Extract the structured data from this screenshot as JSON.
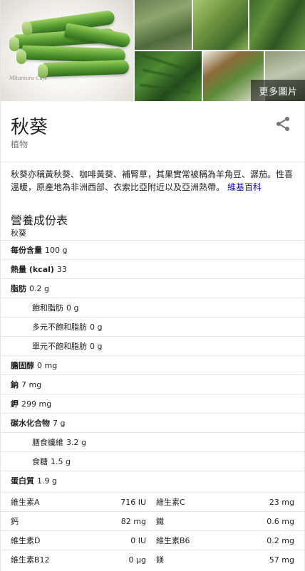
{
  "images": {
    "watermark": "Mitamura Cafe",
    "more_label": "更多圖片"
  },
  "header": {
    "title": "秋葵",
    "subtitle": "植物",
    "share_icon": "share-icon"
  },
  "description": {
    "text": "秋葵亦稱黃秋葵、咖啡黃葵、補腎草，其果實常被稱為羊角豆、潺茄。性喜溫暖，原產地為非洲西部、衣索比亞附近以及亞洲熱帶。",
    "source_link": "維基百科"
  },
  "nutrition": {
    "title": "營養成份表",
    "subject": "秋葵",
    "rows": [
      {
        "label": "每份含量",
        "value": "100 g"
      },
      {
        "label": "熱量 (kcal)",
        "value": "33"
      },
      {
        "label": "脂肪",
        "value": "0.2 g"
      },
      {
        "label": "飽和脂肪",
        "value": "0 g"
      },
      {
        "label": "多元不飽和脂肪",
        "value": "0 g"
      },
      {
        "label": "單元不飽和脂肪",
        "value": "0 g"
      },
      {
        "label": "膽固醇",
        "value": "0 mg"
      },
      {
        "label": "鈉",
        "value": "7 mg"
      },
      {
        "label": "鉀",
        "value": "299 mg"
      },
      {
        "label": "碳水化合物",
        "value": "7 g"
      },
      {
        "label": "膳食纖維",
        "value": "3.2 g"
      },
      {
        "label": "食糖",
        "value": "1.5 g"
      },
      {
        "label": "蛋白質",
        "value": "1.9 g"
      }
    ],
    "vitamins": [
      [
        {
          "label": "維生素A",
          "value": "716 IU"
        },
        {
          "label": "維生素C",
          "value": "23 mg"
        }
      ],
      [
        {
          "label": "鈣",
          "value": "82 mg"
        },
        {
          "label": "鐵",
          "value": "0.6 mg"
        }
      ],
      [
        {
          "label": "維生素D",
          "value": "0 IU"
        },
        {
          "label": "維生素B6",
          "value": "0.2 mg"
        }
      ],
      [
        {
          "label": "維生素B12",
          "value": "0 µg"
        },
        {
          "label": "鎂",
          "value": "57 mg"
        }
      ]
    ]
  }
}
